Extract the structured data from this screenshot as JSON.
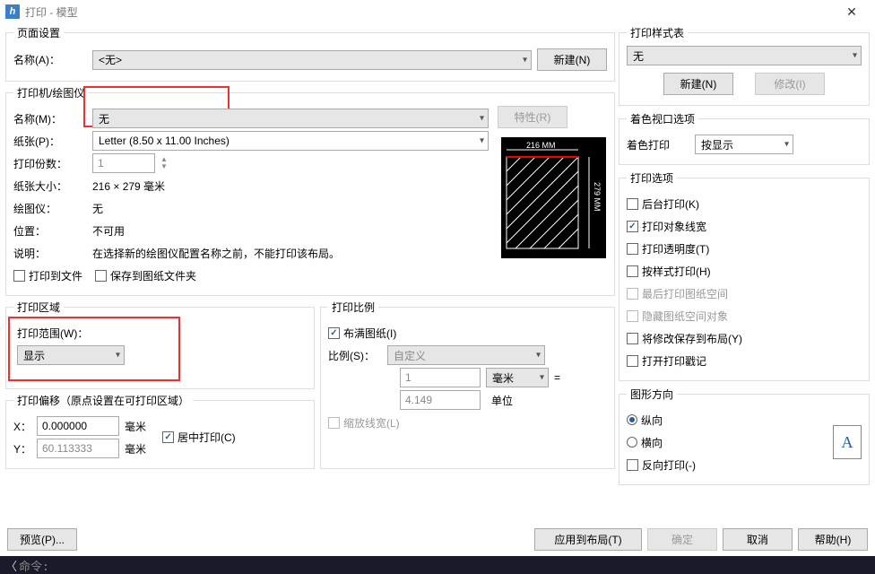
{
  "window": {
    "title": "打印 - 模型"
  },
  "page_setup": {
    "legend": "页面设置",
    "name_label": "名称(A)：",
    "name_value": "<无>",
    "new_btn": "新建(N)"
  },
  "plotter": {
    "legend": "打印机/绘图仪",
    "name_label": "名称(M)：",
    "name_value": "无",
    "properties_btn": "特性(R)",
    "paper_label": "纸张(P)：",
    "paper_value": "Letter (8.50 x 11.00 Inches)",
    "copies_label": "打印份数：",
    "copies_value": "1",
    "size_label": "纸张大小：",
    "size_value": "216 × 279  毫米",
    "plotter_label": "绘图仪：",
    "plotter_value": "无",
    "where_label": "位置：",
    "where_value": "不可用",
    "desc_label": "说明：",
    "desc_value": "在选择新的绘图仪配置名称之前，不能打印该布局。",
    "plot_to_file": "打印到文件",
    "save_to_drawing": "保存到图纸文件夹",
    "preview_dim_top": "216 MM",
    "preview_dim_right": "279 MM"
  },
  "print_area": {
    "legend": "打印区域",
    "range_label": "打印范围(W)：",
    "range_value": "显示"
  },
  "print_offset": {
    "legend": "打印偏移（原点设置在可打印区域）",
    "x_label": "X：",
    "x_value": "0.000000",
    "y_label": "Y：",
    "y_value": "60.113333",
    "unit": "毫米",
    "center": "居中打印(C)"
  },
  "print_scale": {
    "legend": "打印比例",
    "fit_paper": "布满图纸(I)",
    "scale_label": "比例(S)：",
    "scale_value": "自定义",
    "num_value": "1",
    "unit_value": "毫米",
    "equals": "=",
    "den_value": "4.149",
    "den_unit": "单位",
    "scale_lw": "缩放线宽(L)"
  },
  "style_table": {
    "legend": "打印样式表",
    "value": "无",
    "new_btn": "新建(N)",
    "modify_btn": "修改(I)"
  },
  "shaded_viewport": {
    "legend": "着色视口选项",
    "shade_label": "着色打印",
    "shade_value": "按显示"
  },
  "print_options": {
    "legend": "打印选项",
    "items": [
      {
        "label": "后台打印(K)",
        "checked": false,
        "disabled": false
      },
      {
        "label": "打印对象线宽",
        "checked": true,
        "disabled": false
      },
      {
        "label": "打印透明度(T)",
        "checked": false,
        "disabled": false
      },
      {
        "label": "按样式打印(H)",
        "checked": false,
        "disabled": false
      },
      {
        "label": "最后打印图纸空间",
        "checked": false,
        "disabled": true
      },
      {
        "label": "隐藏图纸空间对象",
        "checked": false,
        "disabled": true
      },
      {
        "label": "将修改保存到布局(Y)",
        "checked": false,
        "disabled": false
      },
      {
        "label": "打开打印戳记",
        "checked": false,
        "disabled": false
      }
    ]
  },
  "orientation": {
    "legend": "图形方向",
    "portrait": "纵向",
    "landscape": "横向",
    "reverse": "反向打印(-)",
    "letter": "A"
  },
  "footer": {
    "preview": "预览(P)...",
    "apply": "应用到布局(T)",
    "ok": "确定",
    "cancel": "取消",
    "help": "帮助(H)"
  },
  "cmd": {
    "prompt": "命令:"
  }
}
